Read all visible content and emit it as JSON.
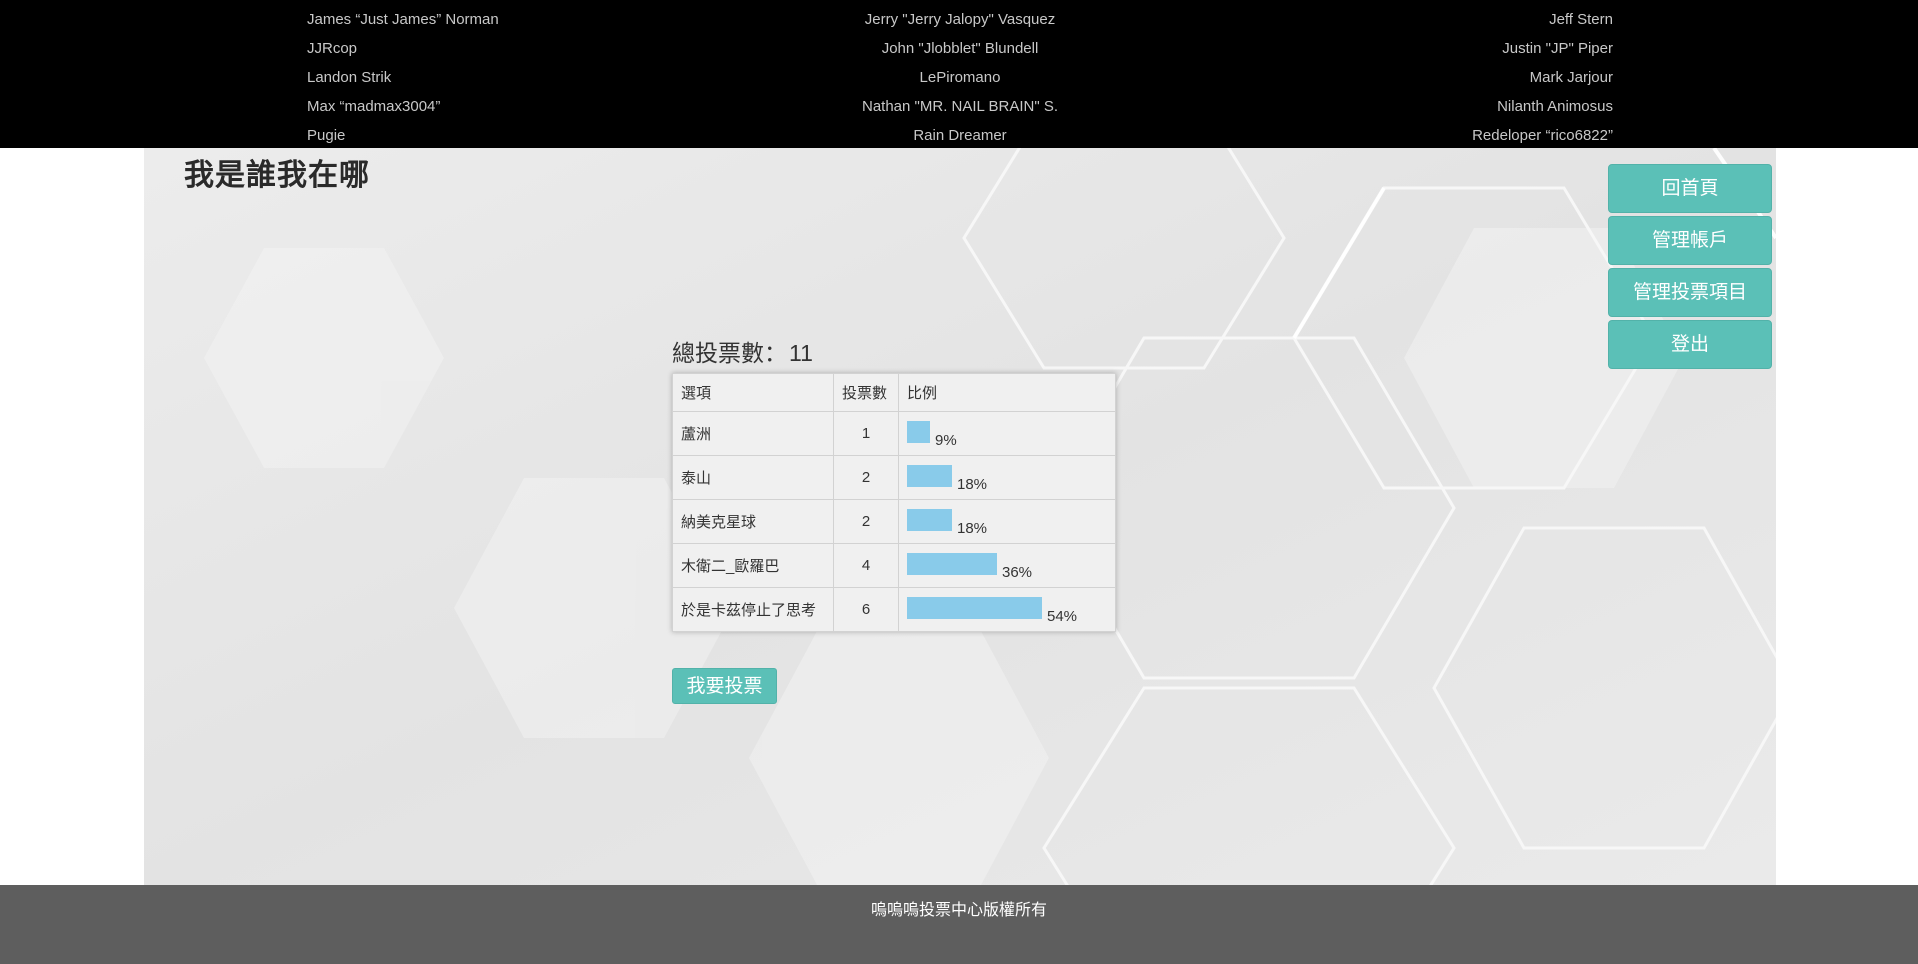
{
  "credits": {
    "left": [
      "James “Just James” Norman",
      "JJRcop",
      "Landon Strik",
      "Max “madmax3004”",
      "Pugie"
    ],
    "middle": [
      "Jerry \"Jerry Jalopy\" Vasquez",
      "John \"Jlobblet\" Blundell",
      "LePiromano",
      "Nathan \"MR. NAIL BRAIN\" S.",
      "Rain Dreamer"
    ],
    "right": [
      "Jeff Stern",
      "Justin \"JP\" Piper",
      "Mark Jarjour",
      "Nilanth Animosus",
      "Redeloper “rico6822”"
    ]
  },
  "site_title": "我是誰我在哪",
  "nav": {
    "home": "回首頁",
    "accounts": "管理帳戶",
    "polls": "管理投票項目",
    "logout": "登出"
  },
  "results": {
    "total_label": "總投票數：",
    "total": "11",
    "headers": {
      "option": "選項",
      "count": "投票數",
      "ratio": "比例"
    },
    "rows": [
      {
        "option": "蘆洲",
        "count": "1",
        "percent": "9%",
        "fraction": 0.09
      },
      {
        "option": "泰山",
        "count": "2",
        "percent": "18%",
        "fraction": 0.18
      },
      {
        "option": "納美克星球",
        "count": "2",
        "percent": "18%",
        "fraction": 0.18
      },
      {
        "option": "木衛二_歐羅巴",
        "count": "4",
        "percent": "36%",
        "fraction": 0.36
      },
      {
        "option": "於是卡茲停止了思考",
        "count": "6",
        "percent": "54%",
        "fraction": 0.54
      }
    ],
    "bar_color": "#89cbea"
  },
  "vote_button": "我要投票",
  "accent_color": "#5bc0b7",
  "footer": {
    "copyright": "嗚嗚嗚投票中心版權所有"
  }
}
